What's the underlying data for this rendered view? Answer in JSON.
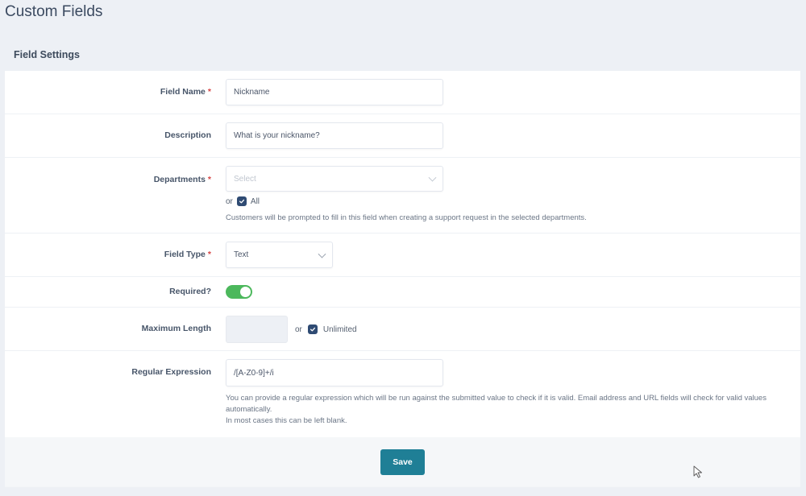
{
  "page": {
    "title": "Custom Fields"
  },
  "card": {
    "title": "Field Settings"
  },
  "form": {
    "field_name": {
      "label": "Field Name",
      "required_mark": "*",
      "value": "Nickname"
    },
    "description": {
      "label": "Description",
      "value": "What is your nickname?"
    },
    "departments": {
      "label": "Departments",
      "required_mark": "*",
      "placeholder": "Select",
      "or_text": "or",
      "all_label": "All",
      "all_checked": true,
      "help": "Customers will be prompted to fill in this field when creating a support request in the selected departments."
    },
    "field_type": {
      "label": "Field Type",
      "required_mark": "*",
      "value": "Text"
    },
    "required": {
      "label": "Required?",
      "enabled": true
    },
    "max_length": {
      "label": "Maximum Length",
      "value": "",
      "or_text": "or",
      "unlimited_label": "Unlimited",
      "unlimited_checked": true
    },
    "regex": {
      "label": "Regular Expression",
      "value": "/[A-Z0-9]+/i",
      "help_line1": "You can provide a regular expression which will be run against the submitted value to check if it is valid. Email address and URL fields will check for valid values automatically.",
      "help_line2": "In most cases this can be left blank."
    }
  },
  "footer": {
    "save_label": "Save"
  },
  "colors": {
    "primary": "#1f7f96",
    "toggle_on": "#4cb85c",
    "checkbox": "#2f4b73",
    "required": "#d64545"
  }
}
